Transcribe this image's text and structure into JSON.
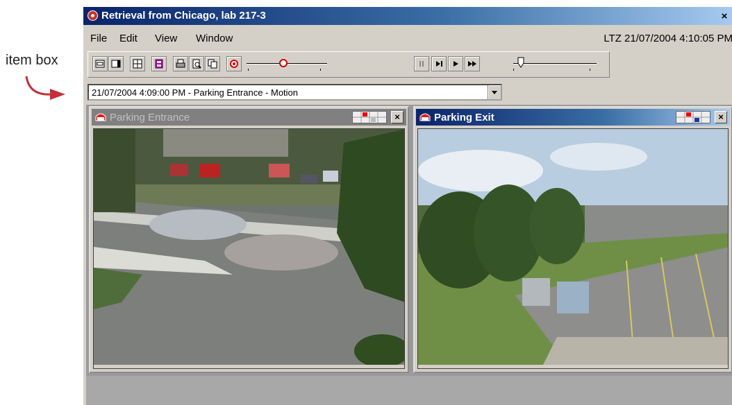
{
  "callout": {
    "label": "item box"
  },
  "window": {
    "title": "Retrieval from Chicago, lab 217-3",
    "close_label": "×"
  },
  "menu": {
    "file": "File",
    "edit": "Edit",
    "view": "View",
    "window": "Window"
  },
  "clock": "LTZ 21/07/2004 4:10:05 PM",
  "toolbar": {
    "icons": [
      "layout-single-icon",
      "layout-side-icon",
      "layout-quad-icon",
      "film-icon",
      "print-icon",
      "preview-icon",
      "copy-icon",
      "record-target-icon",
      "pause-icon",
      "step-forward-icon",
      "play-icon",
      "fast-forward-icon",
      "speed-icon"
    ],
    "position_fraction": 0.45,
    "speed_fraction": 0.05
  },
  "item_box": {
    "value": "21/07/2004 4:09:00 PM - Parking Entrance - Motion"
  },
  "panes": [
    {
      "name": "Parking Entrance",
      "state": "inactive",
      "close_label": "×"
    },
    {
      "name": "Parking Exit",
      "state": "active",
      "close_label": "×"
    }
  ],
  "colors": {
    "accent": "#c00000",
    "title_active": "#0a246a",
    "title_inactive": "#808080",
    "chrome": "#d4d0c8"
  }
}
